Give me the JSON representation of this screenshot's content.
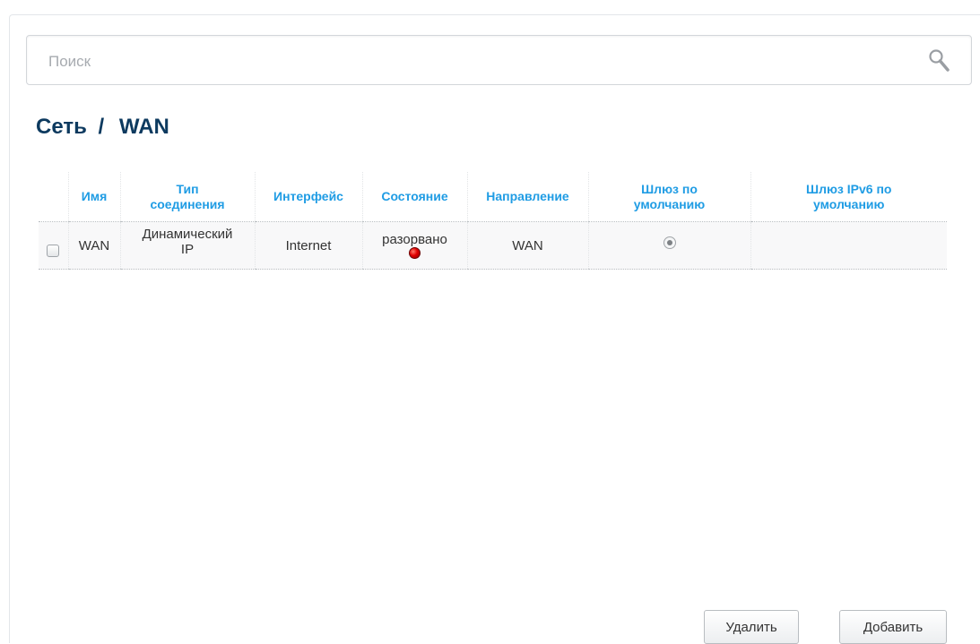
{
  "search": {
    "placeholder": "Поиск"
  },
  "page": {
    "section": "Сеть",
    "separator": "/",
    "subsection": "WAN"
  },
  "table": {
    "headers": {
      "name": "Имя",
      "type_line1": "Тип",
      "type_line2": "соединения",
      "interface": "Интерфейс",
      "state": "Состояние",
      "direction": "Направление",
      "gateway_line1": "Шлюз по",
      "gateway_line2": "умолчанию",
      "gateway6_line1": "Шлюз IPv6 по",
      "gateway6_line2": "умолчанию"
    },
    "rows": [
      {
        "checked": false,
        "name": "WAN",
        "type_line1": "Динамический",
        "type_line2": "IP",
        "interface": "Internet",
        "state": "разорвано",
        "state_color": "#e00000",
        "direction": "WAN",
        "default_gateway": true,
        "default_gateway_ipv6": ""
      }
    ]
  },
  "buttons": {
    "delete": "Удалить",
    "add": "Добавить"
  },
  "colors": {
    "header_text": "#1f9ce4",
    "title": "#0d3a5f",
    "status_disconnected": "#e00000"
  }
}
